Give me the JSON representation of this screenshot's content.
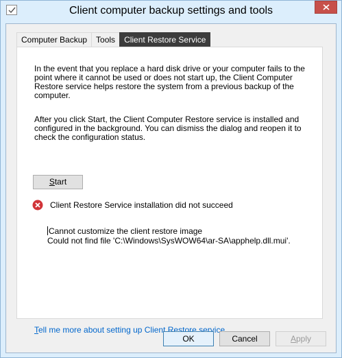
{
  "window": {
    "title": "Client computer backup settings and tools"
  },
  "tabs": [
    {
      "label": "Computer Backup",
      "active": false
    },
    {
      "label": "Tools",
      "active": false
    },
    {
      "label": "Client Restore Service",
      "active": true
    }
  ],
  "content": {
    "paragraph1": "In the event that you replace a hard disk drive or your computer fails to the point where it cannot be used or does not start up, the Client Computer Restore service helps restore the system from a previous backup of the computer.",
    "paragraph2": "After you click Start, the Client Computer Restore service is installed and configured in the background. You can dismiss the dialog and reopen it to check the configuration status.",
    "start_button": {
      "mnemonic": "S",
      "rest": "tart"
    },
    "error_status": "Client Restore Service installation did not succeed",
    "error_details": [
      "Cannot customize the client restore image",
      "Could not find file 'C:\\Windows\\SysWOW64\\ar-SA\\apphelp.dll.mui'."
    ],
    "help_link": {
      "mnemonic": "T",
      "rest": "ell me more about setting up Client Restore service"
    }
  },
  "footer": {
    "ok_label": "OK",
    "cancel_label": "Cancel",
    "apply": {
      "mnemonic": "A",
      "rest": "pply",
      "enabled": false
    }
  },
  "icons": {
    "app": "checkbox-window-icon",
    "close": "close-icon",
    "error": "error-x-icon"
  },
  "colors": {
    "window_frame": "#dceefc",
    "close_button": "#c7504a",
    "active_tab": "#3c3c3c",
    "error_icon": "#d13438",
    "link": "#0066cc"
  }
}
